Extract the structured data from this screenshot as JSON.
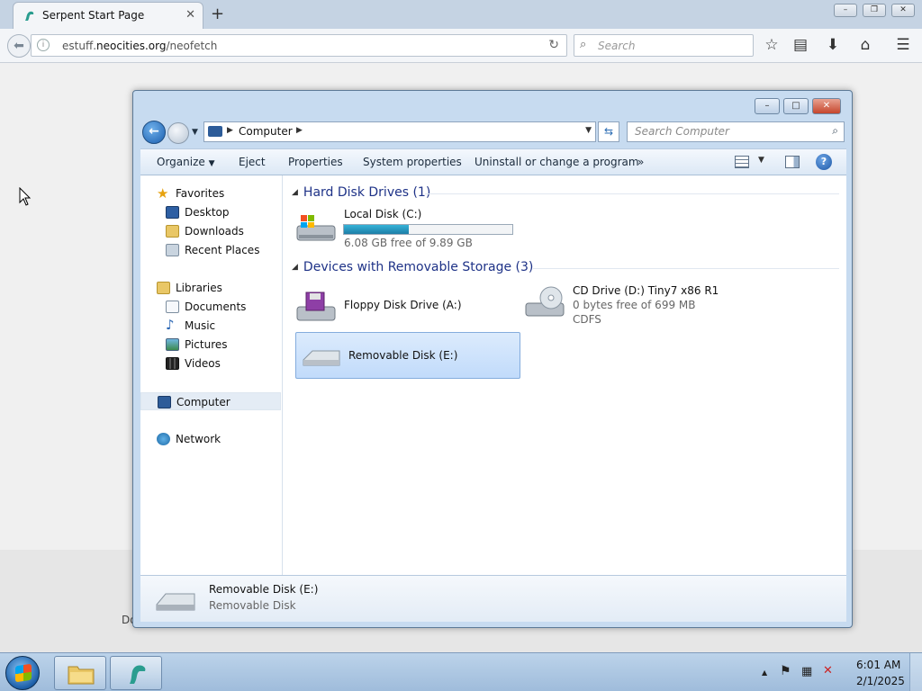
{
  "browser": {
    "tab_title": "Serpent Start Page",
    "tab_close": "✕",
    "new_tab": "+",
    "url_prefix": "estuff.",
    "url_domain": "neocities.org",
    "url_path": "/neofetch",
    "search_placeholder": "Search",
    "window_controls": [
      "–",
      "❐",
      "✕"
    ]
  },
  "page": {
    "bottom_snippet": "Do"
  },
  "explorer": {
    "caption_buttons": [
      "–",
      "□",
      "✕"
    ],
    "breadcrumb": "Computer",
    "search_placeholder": "Search Computer",
    "toolbar": {
      "organize": "Organize",
      "eject": "Eject",
      "properties": "Properties",
      "system_properties": "System properties",
      "uninstall": "Uninstall or change a program",
      "more": "»"
    },
    "nav_pane": {
      "favorites": "Favorites",
      "desktop": "Desktop",
      "downloads": "Downloads",
      "recent_places": "Recent Places",
      "libraries": "Libraries",
      "documents": "Documents",
      "music": "Music",
      "pictures": "Pictures",
      "videos": "Videos",
      "computer": "Computer",
      "network": "Network"
    },
    "groups": {
      "hard_disk_drives": "Hard Disk Drives (1)",
      "removable_storage": "Devices with Removable Storage (3)"
    },
    "drives": {
      "local_disk": {
        "name": "Local Disk (C:)",
        "free": "6.08 GB free of 9.89 GB",
        "used_fraction": 0.385
      },
      "floppy": {
        "name": "Floppy Disk Drive (A:)"
      },
      "cd": {
        "name": "CD Drive (D:) Tiny7 x86 R1",
        "free": "0 bytes free of 699 MB",
        "fs": "CDFS"
      },
      "removable": {
        "name": "Removable Disk (E:)"
      }
    },
    "details": {
      "name": "Removable Disk (E:)",
      "type": "Removable Disk"
    }
  },
  "taskbar": {
    "time": "6:01 AM",
    "date": "2/1/2025",
    "tray_up": "▲"
  },
  "colors": {
    "group_heading": "#1e3287",
    "selection": "#c1dbfb",
    "progress": "#1c7ea7"
  }
}
